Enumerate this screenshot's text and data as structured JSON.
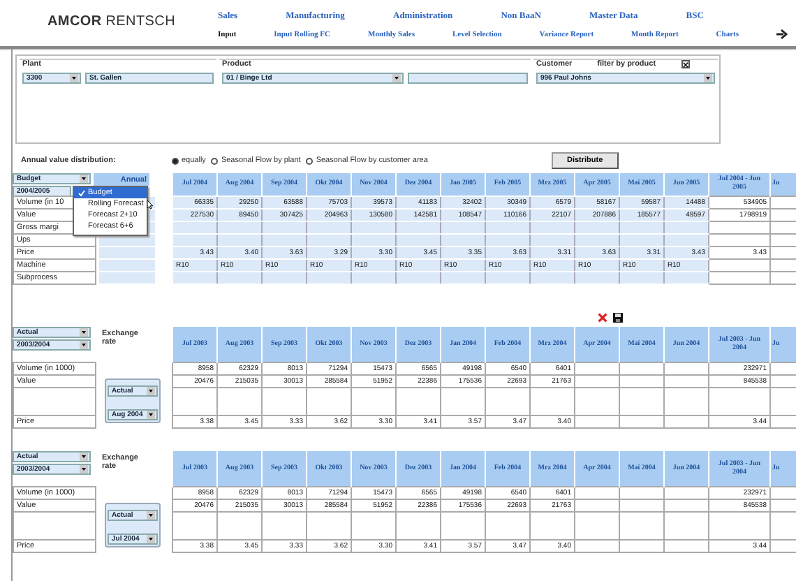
{
  "logo": {
    "brand": "AMCOR",
    "sub": "RENTSCH"
  },
  "nav": {
    "main": [
      "Sales",
      "Manufacturing",
      "Administration",
      "Non BaaN",
      "Master Data",
      "BSC"
    ],
    "sub": [
      {
        "label": "Input",
        "selected": true
      },
      {
        "label": "Input Rolling FC",
        "selected": false
      },
      {
        "label": "Monthly Sales",
        "selected": false
      },
      {
        "label": "Level Selection",
        "selected": false
      },
      {
        "label": "Variance Report",
        "selected": false
      },
      {
        "label": "Month Report",
        "selected": false
      },
      {
        "label": "Charts",
        "selected": false
      }
    ]
  },
  "filters": {
    "plant": {
      "label": "Plant",
      "code": "3300",
      "name": "St. Gallen"
    },
    "product": {
      "label": "Product",
      "value": "01 / Binge Ltd"
    },
    "customer": {
      "label": "Customer",
      "value": "996 Paul Johns",
      "filter_label": "filter by product",
      "filter_checked": true
    }
  },
  "distribution": {
    "label": "Annual value distribution:",
    "options": [
      {
        "label": "equally",
        "selected": true
      },
      {
        "label": "Seasonal Flow by plant",
        "selected": false
      },
      {
        "label": "Seasonal Flow by customer area",
        "selected": false
      }
    ],
    "button": "Distribute"
  },
  "sections": [
    {
      "editable": true,
      "selectors": [
        "Budget",
        "2004/2005"
      ],
      "annual_label": "Annual",
      "dropdown": {
        "options": [
          {
            "label": "Budget",
            "selected": true
          },
          {
            "label": "Rolling Forecast",
            "selected": false
          },
          {
            "label": "Forecast 2+10",
            "selected": false
          },
          {
            "label": "Forecast 6+6",
            "selected": false
          }
        ]
      },
      "columns": [
        "Jul 2004",
        "Aug 2004",
        "Sep 2004",
        "Okt 2004",
        "Nov 2004",
        "Dez 2004",
        "Jan 2005",
        "Feb 2005",
        "Mrz 2005",
        "Apr 2005",
        "Mai 2005",
        "Jun 2005"
      ],
      "total_column": "Jul 2004 - Jun 2005",
      "cut_column": "Ju",
      "rows": [
        {
          "label": "Volume (in 10",
          "kind": "number",
          "values": [
            "66335",
            "29250",
            "63588",
            "75703",
            "39573",
            "41183",
            "32402",
            "30349",
            "6579",
            "58167",
            "59587",
            "14488"
          ],
          "total": "534905"
        },
        {
          "label": "Value",
          "kind": "number",
          "values": [
            "227530",
            "89450",
            "307425",
            "204963",
            "130580",
            "142581",
            "108547",
            "110166",
            "22107",
            "207886",
            "185577",
            "49597"
          ],
          "total": "1798919"
        },
        {
          "label": "Gross margi",
          "kind": "number"
        },
        {
          "label": "Ups",
          "kind": "number"
        },
        {
          "label": "Price",
          "kind": "number",
          "values": [
            "3.43",
            "3.40",
            "3.63",
            "3.29",
            "3.30",
            "3.45",
            "3.35",
            "3.63",
            "3.31",
            "3.63",
            "3.31",
            "3.43"
          ],
          "total": "3.43"
        },
        {
          "label": "Machine",
          "kind": "code",
          "values": [
            "R10",
            "R10",
            "R10",
            "R10",
            "R10",
            "R10",
            "R10",
            "R10",
            "R10",
            "R10",
            "R10",
            "R10"
          ]
        },
        {
          "label": "Subprocess",
          "kind": "number"
        }
      ]
    },
    {
      "editable": false,
      "selectors": [
        "Actual",
        "2003/2004"
      ],
      "exchange": {
        "label": "Exchange rate",
        "selectors": [
          "Actual",
          "Aug 2004"
        ]
      },
      "columns": [
        "Jul 2003",
        "Aug 2003",
        "Sep 2003",
        "Okt 2003",
        "Nov 2003",
        "Dez 2003",
        "Jan 2004",
        "Feb 2004",
        "Mrz 2004",
        "Apr 2004",
        "Mai 2004",
        "Jun 2004"
      ],
      "total_column": "Jul 2003 - Jun 2004",
      "cut_column": "Ju",
      "rows": [
        {
          "label": "Volume (in 1000)",
          "kind": "number",
          "values": [
            "8958",
            "62329",
            "8013",
            "71294",
            "15473",
            "6565",
            "49198",
            "6540",
            "6401"
          ],
          "total": "232971"
        },
        {
          "label": "Value",
          "kind": "number",
          "values": [
            "20476",
            "215035",
            "30013",
            "285584",
            "51952",
            "22386",
            "175536",
            "22693",
            "21763"
          ],
          "total": "845538"
        }
      ],
      "footer_rows": [
        {
          "label": "Price",
          "values": [
            "3.38",
            "3.45",
            "3.33",
            "3.62",
            "3.30",
            "3.41",
            "3.57",
            "3.47",
            "3.40"
          ],
          "total": "3.44"
        }
      ]
    },
    {
      "editable": false,
      "selectors": [
        "Actual",
        "2003/2004"
      ],
      "exchange": {
        "label": "Exchange rate",
        "selectors": [
          "Actual",
          "Jul 2004"
        ]
      },
      "columns": [
        "Jul 2003",
        "Aug 2003",
        "Sep 2003",
        "Okt 2003",
        "Nov 2003",
        "Dez 2003",
        "Jan 2004",
        "Feb 2004",
        "Mrz 2004",
        "Apr 2004",
        "Mai 2004",
        "Jun 2004"
      ],
      "total_column": "Jul 2003 - Jun 2004",
      "cut_column": "Ju",
      "rows": [
        {
          "label": "Volume (in 1000)",
          "kind": "number",
          "values": [
            "8958",
            "62329",
            "8013",
            "71294",
            "15473",
            "6565",
            "49198",
            "6540",
            "6401"
          ],
          "total": "232971"
        },
        {
          "label": "Value",
          "kind": "number",
          "values": [
            "20476",
            "215035",
            "30013",
            "285584",
            "51952",
            "22386",
            "175536",
            "22693",
            "21763"
          ],
          "total": "845538"
        }
      ],
      "footer_rows": [
        {
          "label": "Price",
          "values": [
            "3.38",
            "3.45",
            "3.33",
            "3.62",
            "3.30",
            "3.41",
            "3.57",
            "3.47",
            "3.40"
          ],
          "total": "3.44"
        }
      ]
    }
  ]
}
